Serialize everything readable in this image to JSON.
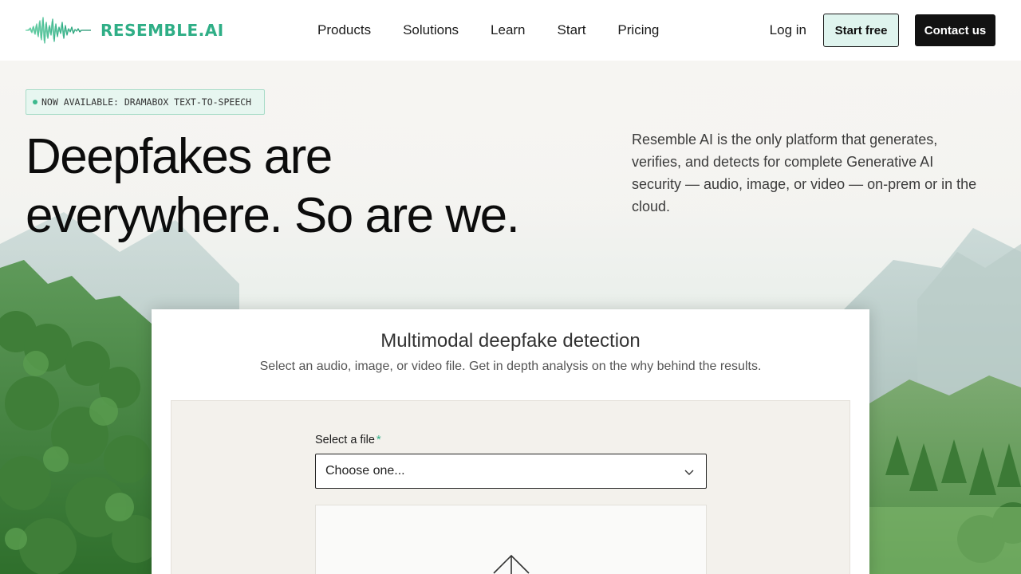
{
  "brand": {
    "name": "RESEMBLE.AI",
    "color": "#2fae86"
  },
  "nav": {
    "items": [
      "Products",
      "Solutions",
      "Learn",
      "Start",
      "Pricing"
    ]
  },
  "header": {
    "login_label": "Log in",
    "start_free_label": "Start free",
    "contact_label": "Contact us"
  },
  "hero": {
    "badge": "NOW AVAILABLE: DRAMABOX TEXT-TO-SPEECH",
    "headline_line1": "Deepfakes are",
    "headline_line2": "everywhere. So are we.",
    "intro": "Resemble AI is the only platform that generates, verifies, and detects for complete Generative AI security — audio, image, or video — on-prem or in the cloud."
  },
  "detection": {
    "title": "Multimodal deepfake detection",
    "subtitle": "Select an audio, image, or video file. Get in depth analysis on the why behind the results.",
    "file_label": "Select a file",
    "required_mark": "*",
    "select_value": "Choose one...",
    "upload_icon": "upload-arrow-icon"
  },
  "colors": {
    "accent": "#2fae86",
    "badge_bg": "#e7f6f0",
    "start_free_bg": "#dff4ee",
    "contact_bg": "#121212"
  }
}
